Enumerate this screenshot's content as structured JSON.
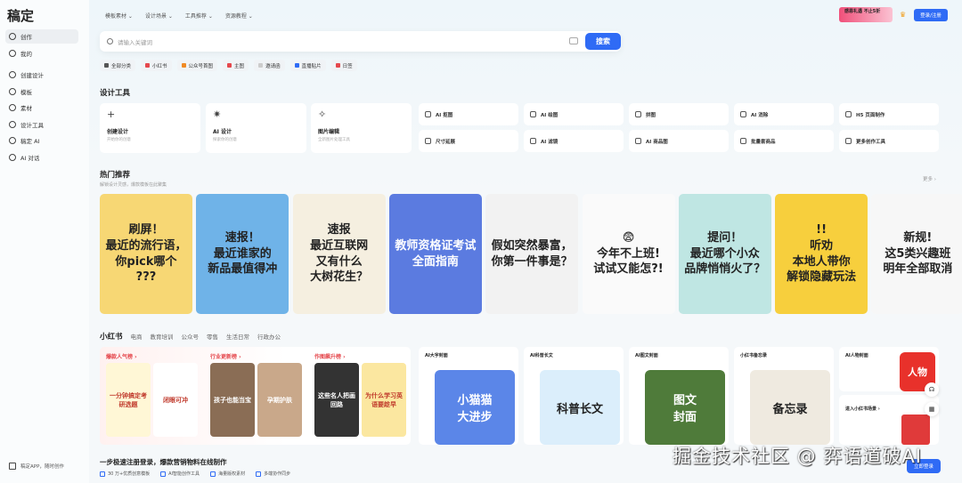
{
  "app": {
    "logo": "稿定"
  },
  "sidebar": {
    "items": [
      {
        "label": "创作"
      },
      {
        "label": "我的"
      },
      {
        "label": "创建设计"
      },
      {
        "label": "模板"
      },
      {
        "label": "素材"
      },
      {
        "label": "设计工具"
      },
      {
        "label": "稿定 AI"
      },
      {
        "label": "AI 对话"
      }
    ],
    "footer": "稿定APP，随时创作"
  },
  "nav": [
    "模板素材",
    "设计场景",
    "工具推荐",
    "资源教程"
  ],
  "header": {
    "promo": "感恩礼遇 不止5折",
    "login": "登录/注册"
  },
  "search": {
    "placeholder": "请输入关键词",
    "button": "搜索"
  },
  "chips": [
    {
      "label": "全部分类",
      "color": "#555"
    },
    {
      "label": "小红书",
      "color": "#e5484d"
    },
    {
      "label": "公众号首图",
      "color": "#f08a24"
    },
    {
      "label": "主图",
      "color": "#e5484d"
    },
    {
      "label": "邀请函",
      "color": "#ccc"
    },
    {
      "label": "直播贴片",
      "color": "#2f6bf5"
    },
    {
      "label": "日签",
      "color": "#e5484d"
    }
  ],
  "design_tools": {
    "title": "设计工具",
    "big": [
      {
        "title": "创建设计",
        "sub": "开始你的创意",
        "icon": "+"
      },
      {
        "title": "AI 设计",
        "sub": "探索你的创意",
        "icon": "✷"
      },
      {
        "title": "图片编辑",
        "sub": "全新图片处理工具",
        "icon": "✧"
      }
    ],
    "small": [
      [
        "AI 抠图",
        "AI 绘图",
        "拼图",
        "AI 消除",
        "H5 页面制作"
      ],
      [
        "尺寸延展",
        "AI 滤镜",
        "AI 商品图",
        "批量套商品",
        "更多创作工具"
      ]
    ]
  },
  "hot": {
    "title": "热门推荐",
    "sub": "解锁设计灵感，爆款模板在此聚集",
    "more": "更多 ›",
    "posters": [
      {
        "text": "刷屏！\n最近的流行语，\n你pick哪个\n???",
        "bg": "#f7d774"
      },
      {
        "text": "速报！\n最近谁家的\n新品最值得冲",
        "bg": "#6fb3e8"
      },
      {
        "text": "速报\n最近互联网\n又有什么\n大树花生？",
        "bg": "#f5efe0"
      },
      {
        "text": "教师资格证考试\n全面指南",
        "bg": "#5b7be0"
      },
      {
        "text": "假如突然暴富，\n你第一件事是？",
        "bg": "#f2f2f2"
      },
      {
        "text": "😨\n今年不上班!\n试试又能怎?!",
        "bg": "#fafafa"
      },
      {
        "text": "提问！\n最近哪个小众\n品牌悄悄火了？",
        "bg": "#bfe6e3"
      },
      {
        "text": "!!\n听劝\n本地人带你\n解锁隐藏玩法",
        "bg": "#f7cf3d"
      },
      {
        "text": "新规!\n这5类兴趣班\n明年全部取消",
        "bg": "#f7f7f7"
      }
    ]
  },
  "xhs": {
    "tabs": [
      "小红书",
      "电商",
      "教育培训",
      "公众号",
      "零售",
      "生活日常",
      "行政办公"
    ],
    "ranks": [
      {
        "label": "爆款人气榜 ›",
        "thumbs": [
          "一分钟搞定考研选题",
          "闭眼可冲"
        ]
      },
      {
        "label": "行业更新榜 ›",
        "thumbs": [
          "孩子也能当宝",
          "孕期护肤"
        ]
      },
      {
        "label": "作图飙升榜 ›",
        "thumbs": [
          "这些名人把画回路",
          "为什么学习英语要趁早"
        ]
      }
    ],
    "cards": [
      {
        "title": "AI大字封面",
        "img": "小猫猫\n大进步",
        "bg": "#5b86e8"
      },
      {
        "title": "AI科普长文",
        "img": "科普长文",
        "bg": "#dbeefb"
      },
      {
        "title": "AI图文封面",
        "img": "图文\n封面",
        "bg": "#4f7b3a"
      },
      {
        "title": "小红书备忘录",
        "img": "备忘录",
        "bg": "#efeae0"
      },
      {
        "title": "AI人物封面",
        "img": "人物",
        "bg": "#e8312b"
      }
    ],
    "enter": "进入小红书场景 ›"
  },
  "register": {
    "title": "一步极速注册登录，爆款营销物料在线制作",
    "features": [
      "30 万+优质创意模板",
      "AI智能创作工具",
      "海量版权素材",
      "多端协作同步"
    ],
    "button": "立即登录"
  },
  "watermark": "掘金技术社区 @ 弈语道破AI"
}
